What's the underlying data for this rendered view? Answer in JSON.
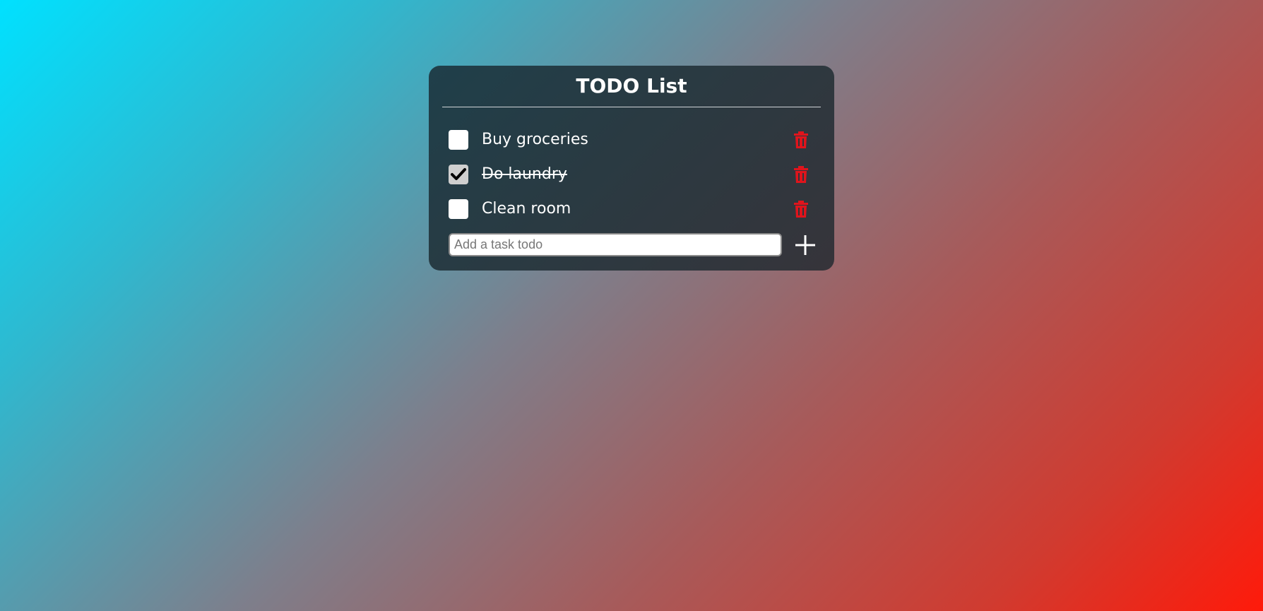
{
  "app": {
    "title": "TODO List"
  },
  "todos": [
    {
      "label": "Buy groceries",
      "checked": false
    },
    {
      "label": "Do laundry",
      "checked": true
    },
    {
      "label": "Clean room",
      "checked": false
    }
  ],
  "add_task": {
    "placeholder": "Add a task todo",
    "value": "",
    "button_icon": "plus-icon"
  },
  "icons": {
    "delete": "trash-icon",
    "check": "checkmark-icon"
  },
  "colors": {
    "delete_icon": "#e0141c",
    "text": "#ffffff",
    "card_bg": "#2a3a42"
  }
}
